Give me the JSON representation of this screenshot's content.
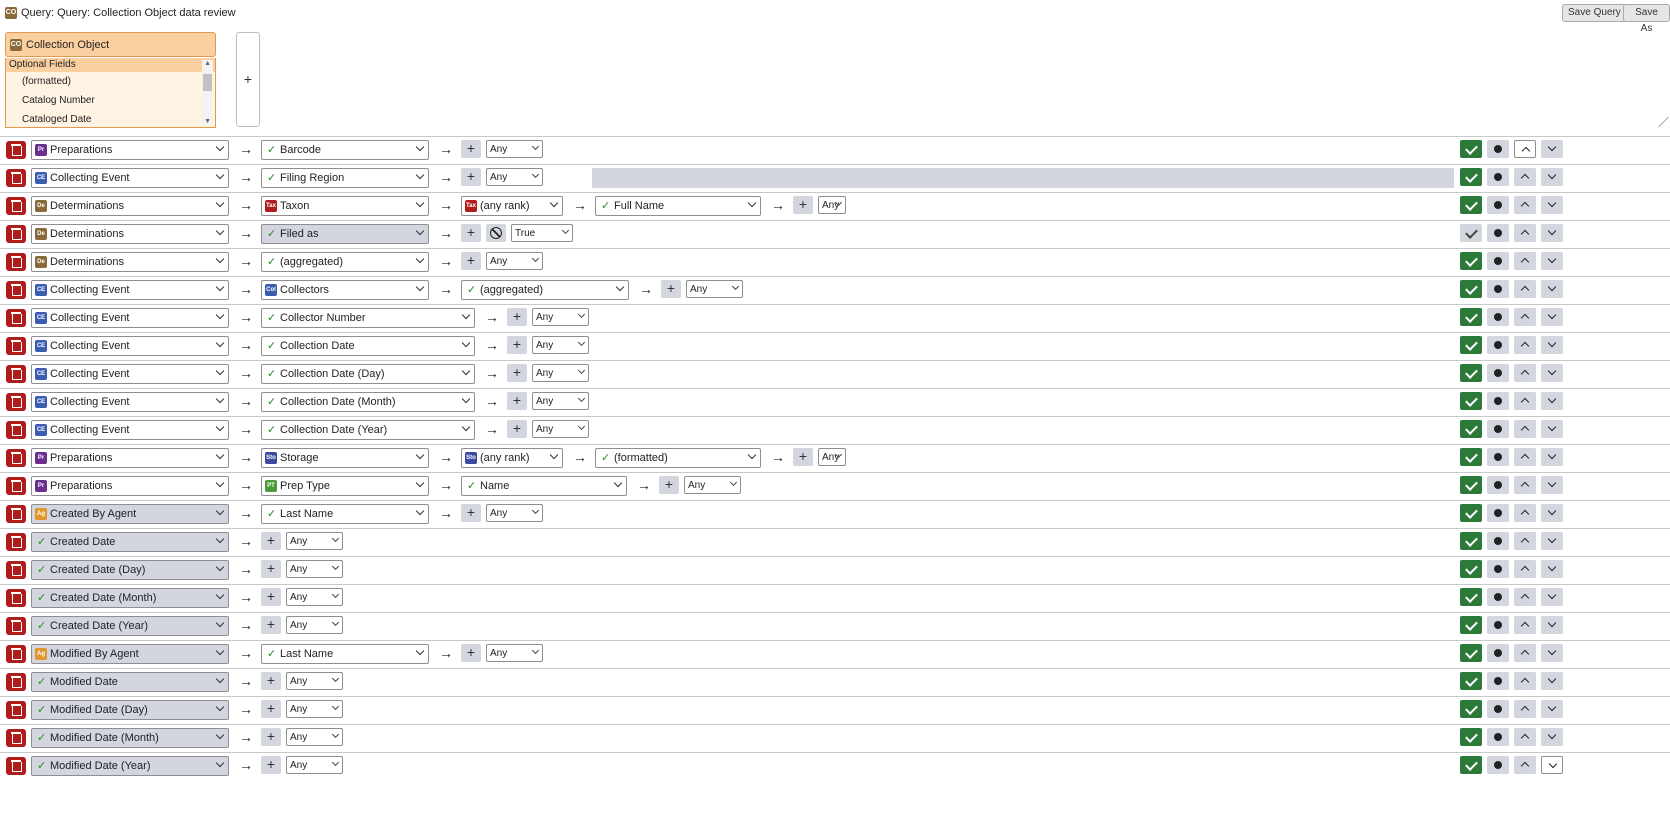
{
  "header": {
    "title": "Query: Query: Collection Object data review",
    "title_icon": "CO",
    "save_query_label": "Save Query",
    "save_as_label": "Save As"
  },
  "tree": {
    "table_label": "Collection Object",
    "table_icon": "CO",
    "optional_fields_label": "Optional Fields",
    "fields": [
      "(formatted)",
      "Catalog Number",
      "Cataloged Date"
    ],
    "add_label": "+"
  },
  "colors": {
    "accent_green": "#2b7a3a",
    "delete_red": "#b01c1c",
    "tree_orange": "#fbd0a0"
  },
  "rows": [
    {
      "show": true,
      "up_white": true,
      "segments": [
        {
          "t": "sel",
          "icon": "Pr",
          "icon_color": "#6a2f8f",
          "label": "Preparations"
        },
        {
          "t": "arrow"
        },
        {
          "t": "sel",
          "check": true,
          "label": "Barcode"
        },
        {
          "t": "arrow"
        },
        {
          "t": "plus"
        },
        {
          "t": "any",
          "label": "Any"
        }
      ]
    },
    {
      "show": true,
      "graybar": true,
      "segments": [
        {
          "t": "sel",
          "icon": "CE",
          "icon_color": "#3a5db0",
          "label": "Collecting Event"
        },
        {
          "t": "arrow"
        },
        {
          "t": "sel",
          "check": true,
          "label": "Filing Region"
        },
        {
          "t": "arrow"
        },
        {
          "t": "plus"
        },
        {
          "t": "any",
          "label": "Any"
        }
      ]
    },
    {
      "show": true,
      "segments": [
        {
          "t": "sel",
          "icon": "De",
          "icon_color": "#8a6a3a",
          "label": "Determinations"
        },
        {
          "t": "arrow"
        },
        {
          "t": "sel",
          "icon": "Tax",
          "icon_color": "#b01c1c",
          "label": "Taxon"
        },
        {
          "t": "arrow"
        },
        {
          "t": "sel",
          "icon": "Tax",
          "icon_color": "#b01c1c",
          "label": "(any rank)"
        },
        {
          "t": "arrow"
        },
        {
          "t": "sel",
          "check": true,
          "label": "Full Name"
        },
        {
          "t": "arrow"
        },
        {
          "t": "plus"
        },
        {
          "t": "any",
          "label": "Any"
        }
      ]
    },
    {
      "show": false,
      "segments": [
        {
          "t": "sel",
          "icon": "De",
          "icon_color": "#8a6a3a",
          "label": "Determinations"
        },
        {
          "t": "arrow"
        },
        {
          "t": "sel",
          "check": true,
          "gray": true,
          "label": "Filed as"
        },
        {
          "t": "arrow"
        },
        {
          "t": "plus"
        },
        {
          "t": "null"
        },
        {
          "t": "any",
          "label": "True"
        }
      ]
    },
    {
      "show": true,
      "segments": [
        {
          "t": "sel",
          "icon": "De",
          "icon_color": "#8a6a3a",
          "label": "Determinations"
        },
        {
          "t": "arrow"
        },
        {
          "t": "sel",
          "check": true,
          "label": "(aggregated)"
        },
        {
          "t": "arrow"
        },
        {
          "t": "plus"
        },
        {
          "t": "any",
          "label": "Any"
        }
      ]
    },
    {
      "show": true,
      "segments": [
        {
          "t": "sel",
          "icon": "CE",
          "icon_color": "#3a5db0",
          "label": "Collecting Event"
        },
        {
          "t": "arrow"
        },
        {
          "t": "sel",
          "icon": "Col",
          "icon_color": "#3a5db0",
          "label": "Collectors"
        },
        {
          "t": "arrow"
        },
        {
          "t": "sel",
          "check": true,
          "label": "(aggregated)"
        },
        {
          "t": "arrow"
        },
        {
          "t": "plus"
        },
        {
          "t": "any",
          "label": "Any"
        }
      ]
    },
    {
      "show": true,
      "segments": [
        {
          "t": "sel",
          "icon": "CE",
          "icon_color": "#3a5db0",
          "label": "Collecting Event"
        },
        {
          "t": "arrow"
        },
        {
          "t": "sel",
          "check": true,
          "label": "Collector Number"
        },
        {
          "t": "arrow"
        },
        {
          "t": "plus"
        },
        {
          "t": "any",
          "label": "Any"
        }
      ]
    },
    {
      "show": true,
      "segments": [
        {
          "t": "sel",
          "icon": "CE",
          "icon_color": "#3a5db0",
          "label": "Collecting Event"
        },
        {
          "t": "arrow"
        },
        {
          "t": "sel",
          "check": true,
          "label": "Collection Date"
        },
        {
          "t": "arrow"
        },
        {
          "t": "plus"
        },
        {
          "t": "any",
          "label": "Any"
        }
      ]
    },
    {
      "show": true,
      "segments": [
        {
          "t": "sel",
          "icon": "CE",
          "icon_color": "#3a5db0",
          "label": "Collecting Event"
        },
        {
          "t": "arrow"
        },
        {
          "t": "sel",
          "check": true,
          "label": "Collection Date (Day)"
        },
        {
          "t": "arrow"
        },
        {
          "t": "plus"
        },
        {
          "t": "any",
          "label": "Any"
        }
      ]
    },
    {
      "show": true,
      "segments": [
        {
          "t": "sel",
          "icon": "CE",
          "icon_color": "#3a5db0",
          "label": "Collecting Event"
        },
        {
          "t": "arrow"
        },
        {
          "t": "sel",
          "check": true,
          "label": "Collection Date (Month)"
        },
        {
          "t": "arrow"
        },
        {
          "t": "plus"
        },
        {
          "t": "any",
          "label": "Any"
        }
      ]
    },
    {
      "show": true,
      "segments": [
        {
          "t": "sel",
          "icon": "CE",
          "icon_color": "#3a5db0",
          "label": "Collecting Event"
        },
        {
          "t": "arrow"
        },
        {
          "t": "sel",
          "check": true,
          "label": "Collection Date (Year)"
        },
        {
          "t": "arrow"
        },
        {
          "t": "plus"
        },
        {
          "t": "any",
          "label": "Any"
        }
      ]
    },
    {
      "show": true,
      "segments": [
        {
          "t": "sel",
          "icon": "Pr",
          "icon_color": "#6a2f8f",
          "label": "Preparations"
        },
        {
          "t": "arrow"
        },
        {
          "t": "sel",
          "icon": "Sto",
          "icon_color": "#3a4aa0",
          "label": "Storage"
        },
        {
          "t": "arrow"
        },
        {
          "t": "sel",
          "icon": "Sto",
          "icon_color": "#3a4aa0",
          "label": "(any rank)"
        },
        {
          "t": "arrow"
        },
        {
          "t": "sel",
          "check": true,
          "label": "(formatted)"
        },
        {
          "t": "arrow"
        },
        {
          "t": "plus"
        },
        {
          "t": "any",
          "label": "Any"
        }
      ]
    },
    {
      "show": true,
      "segments": [
        {
          "t": "sel",
          "icon": "Pr",
          "icon_color": "#6a2f8f",
          "label": "Preparations"
        },
        {
          "t": "arrow"
        },
        {
          "t": "sel",
          "icon": "PT",
          "icon_color": "#4a9a3a",
          "label": "Prep Type"
        },
        {
          "t": "arrow"
        },
        {
          "t": "sel",
          "check": true,
          "label": "Name"
        },
        {
          "t": "arrow"
        },
        {
          "t": "plus"
        },
        {
          "t": "any",
          "label": "Any"
        }
      ]
    },
    {
      "show": true,
      "segments": [
        {
          "t": "sel",
          "icon": "Ag",
          "icon_color": "#e0962a",
          "gray": true,
          "label": "Created By Agent"
        },
        {
          "t": "arrow"
        },
        {
          "t": "sel",
          "check": true,
          "label": "Last Name"
        },
        {
          "t": "arrow"
        },
        {
          "t": "plus"
        },
        {
          "t": "any",
          "label": "Any"
        }
      ]
    },
    {
      "show": true,
      "segments": [
        {
          "t": "sel",
          "check": true,
          "gray": true,
          "label": "Created Date"
        },
        {
          "t": "arrow"
        },
        {
          "t": "plus"
        },
        {
          "t": "any",
          "label": "Any"
        }
      ]
    },
    {
      "show": true,
      "segments": [
        {
          "t": "sel",
          "check": true,
          "gray": true,
          "label": "Created Date (Day)"
        },
        {
          "t": "arrow"
        },
        {
          "t": "plus"
        },
        {
          "t": "any",
          "label": "Any"
        }
      ]
    },
    {
      "show": true,
      "segments": [
        {
          "t": "sel",
          "check": true,
          "gray": true,
          "label": "Created Date (Month)"
        },
        {
          "t": "arrow"
        },
        {
          "t": "plus"
        },
        {
          "t": "any",
          "label": "Any"
        }
      ]
    },
    {
      "show": true,
      "segments": [
        {
          "t": "sel",
          "check": true,
          "gray": true,
          "label": "Created Date (Year)"
        },
        {
          "t": "arrow"
        },
        {
          "t": "plus"
        },
        {
          "t": "any",
          "label": "Any"
        }
      ]
    },
    {
      "show": true,
      "segments": [
        {
          "t": "sel",
          "icon": "Ag",
          "icon_color": "#e0962a",
          "gray": true,
          "label": "Modified By Agent"
        },
        {
          "t": "arrow"
        },
        {
          "t": "sel",
          "check": true,
          "label": "Last Name"
        },
        {
          "t": "arrow"
        },
        {
          "t": "plus"
        },
        {
          "t": "any",
          "label": "Any"
        }
      ]
    },
    {
      "show": true,
      "segments": [
        {
          "t": "sel",
          "check": true,
          "gray": true,
          "label": "Modified Date"
        },
        {
          "t": "arrow"
        },
        {
          "t": "plus"
        },
        {
          "t": "any",
          "label": "Any"
        }
      ]
    },
    {
      "show": true,
      "segments": [
        {
          "t": "sel",
          "check": true,
          "gray": true,
          "label": "Modified Date (Day)"
        },
        {
          "t": "arrow"
        },
        {
          "t": "plus"
        },
        {
          "t": "any",
          "label": "Any"
        }
      ]
    },
    {
      "show": true,
      "segments": [
        {
          "t": "sel",
          "check": true,
          "gray": true,
          "label": "Modified Date (Month)"
        },
        {
          "t": "arrow"
        },
        {
          "t": "plus"
        },
        {
          "t": "any",
          "label": "Any"
        }
      ]
    },
    {
      "show": true,
      "down_white": true,
      "segments": [
        {
          "t": "sel",
          "check": true,
          "gray": true,
          "label": "Modified Date (Year)"
        },
        {
          "t": "arrow"
        },
        {
          "t": "plus"
        },
        {
          "t": "any",
          "label": "Any"
        }
      ]
    }
  ]
}
